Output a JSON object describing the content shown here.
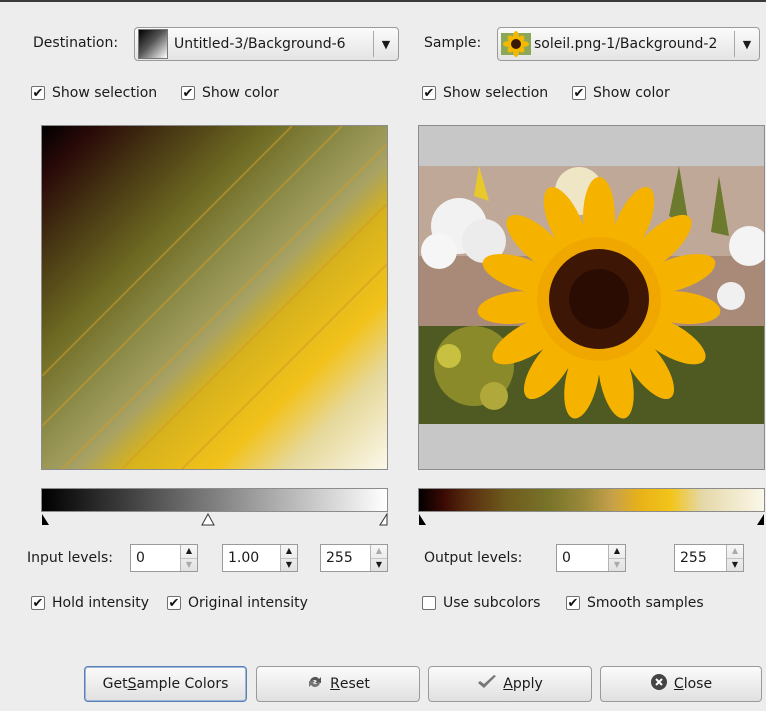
{
  "destination": {
    "label": "Destination:",
    "value": "Untitled-3/Background-6",
    "icon": "gradient-thumbnail-icon"
  },
  "sample": {
    "label": "Sample:",
    "value": "soleil.png-1/Background-2",
    "icon": "sunflower-thumbnail-icon"
  },
  "left_options": {
    "show_selection": "Show selection",
    "show_color": "Show color"
  },
  "right_options": {
    "show_selection": "Show selection",
    "show_color": "Show color"
  },
  "input_levels": {
    "label": "Input levels:",
    "low": "0",
    "gamma": "1.00",
    "high": "255"
  },
  "output_levels": {
    "label": "Output levels:",
    "low": "0",
    "high": "255"
  },
  "left_bottom": {
    "hold_intensity": "Hold intensity",
    "original_intensity": "Original intensity"
  },
  "right_bottom": {
    "use_subcolors": "Use subcolors",
    "smooth_samples": "Smooth samples"
  },
  "buttons": {
    "get_sample_pre": "Get ",
    "get_sample_u": "S",
    "get_sample_post": "ample Colors",
    "reset_u": "R",
    "reset_post": "eset",
    "apply_u": "A",
    "apply_post": "pply",
    "close_u": "C",
    "close_post": "lose"
  },
  "checkboxes": {
    "left_show_selection": true,
    "left_show_color": true,
    "right_show_selection": true,
    "right_show_color": true,
    "hold_intensity": true,
    "original_intensity": true,
    "use_subcolors": false,
    "smooth_samples": true
  }
}
